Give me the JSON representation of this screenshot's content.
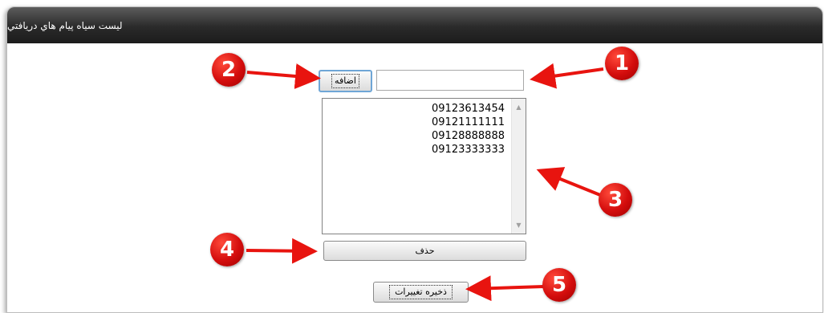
{
  "window": {
    "title": "ليست سياه پيام هاي دريافتي"
  },
  "form": {
    "add_button_label": "اضافه",
    "number_input_value": "",
    "blacklist": [
      "09123613454",
      "09121111111",
      "09128888888",
      "09123333333"
    ],
    "delete_button_label": "حذف",
    "save_button_label": "ذخيره تغييرات"
  },
  "annotations": {
    "badge_1": "1",
    "badge_2": "2",
    "badge_3": "3",
    "badge_4": "4",
    "badge_5": "5",
    "annotation_color": "#e8140f"
  },
  "icons": {
    "scroll_up": "scroll-up-arrow",
    "scroll_down": "scroll-down-arrow"
  }
}
